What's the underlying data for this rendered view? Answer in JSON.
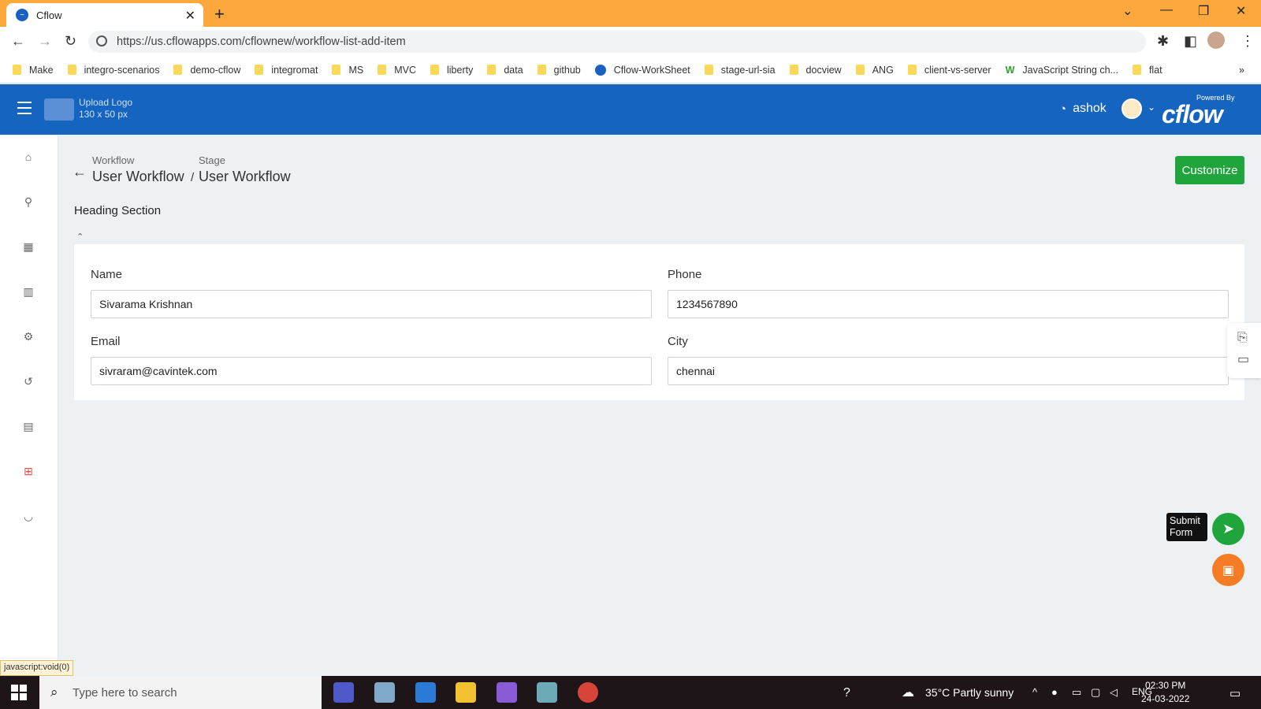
{
  "browser": {
    "tab_title": "Cflow",
    "url": "https://us.cflowapps.com/cflownew/workflow-list-add-item",
    "bookmarks": [
      "Make",
      "integro-scenarios",
      "demo-cflow",
      "integromat",
      "MS",
      "MVC",
      "liberty",
      "data",
      "github",
      "Cflow-WorkSheet",
      "stage-url-sia",
      "docview",
      "ANG",
      "client-vs-server",
      "JavaScript String ch...",
      "flat"
    ],
    "overflow": "»"
  },
  "header": {
    "logo_line1": "Upload Logo",
    "logo_line2": "130 x 50 px",
    "username": "ashok",
    "powered_by": "Powered By",
    "brand": "cflow"
  },
  "breadcrumb": {
    "workflow_label": "Workflow",
    "workflow_value": "User Workflow",
    "separator": "/",
    "stage_label": "Stage",
    "stage_value": "User Workflow"
  },
  "customize_label": "Customize",
  "section_heading": "Heading Section",
  "form": {
    "name_label": "Name",
    "name_value": "Sivarama Krishnan",
    "phone_label": "Phone",
    "phone_value": "1234567890",
    "email_label": "Email",
    "email_value": "sivraram@cavintek.com",
    "city_label": "City",
    "city_value": "chennai"
  },
  "submit_tooltip": "Submit Form",
  "statusbar": "javascript:void(0)",
  "taskbar": {
    "search_placeholder": "Type here to search",
    "weather": "35°C  Partly sunny",
    "lang": "ENG",
    "time": "02:30 PM",
    "date": "24-03-2022"
  },
  "colors": {
    "header_blue": "#1565c0",
    "accent_green": "#1fa53b",
    "save_orange": "#f57c25",
    "tabbar_orange": "#fda83c"
  }
}
